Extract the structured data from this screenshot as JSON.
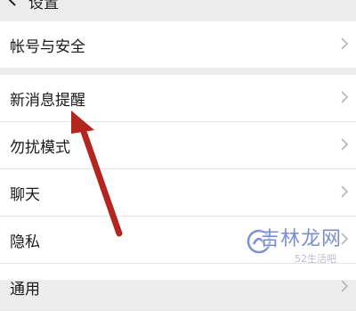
{
  "header": {
    "title": "设置",
    "back_icon": "chevron-left-icon"
  },
  "groups": [
    {
      "items": [
        {
          "label": "帐号与安全"
        }
      ]
    },
    {
      "items": [
        {
          "label": "新消息提醒"
        },
        {
          "label": "勿扰模式"
        },
        {
          "label": "聊天"
        },
        {
          "label": "隐私"
        },
        {
          "label": "通用"
        }
      ]
    }
  ],
  "annotation": {
    "type": "red-arrow",
    "target": "新消息提醒",
    "color": "#c0392b"
  },
  "watermark": {
    "text": "吉林龙网",
    "subtext": "52生活吧",
    "color": "#7a8fd0"
  },
  "colors": {
    "background": "#ededed",
    "row_bg": "#ffffff",
    "divider": "#e5e5e5",
    "chevron": "#b5b5b5"
  }
}
